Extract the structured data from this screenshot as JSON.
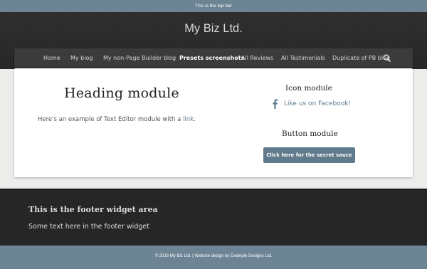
{
  "topbar": {
    "text": "This is the top bar"
  },
  "header": {
    "site_title": "My Biz Ltd."
  },
  "nav": {
    "items": [
      {
        "label": "Home"
      },
      {
        "label": "My blog"
      },
      {
        "label": "My non-Page Builder blog"
      },
      {
        "label": "Presets screenshots",
        "active": true
      },
      {
        "label": "All Reviews"
      },
      {
        "label": "All Testimonials"
      },
      {
        "label": "Duplicate of PB blog"
      }
    ],
    "search_icon": "search-icon"
  },
  "main": {
    "heading": "Heading module",
    "text_before_link": "Here's an example of Text Editor module with a ",
    "link_text": "link",
    "text_after_link": ".",
    "icon_module_title": "Icon module",
    "facebook_icon": "facebook-icon",
    "facebook_label": "Like us on Facebook!",
    "button_module_title": "Button module",
    "button_label": "Click here for the secret sauce",
    "colors": {
      "link": "#5b7c8f",
      "button": "#5f7a8b"
    }
  },
  "footer": {
    "title": "This is the footer widget area",
    "text": "Some text here in the footer widget"
  },
  "bottombar": {
    "text": "© 2016 My Biz Ltd. | Website design by Example Designs Ltd."
  },
  "colors": {
    "bars": "#6c8494",
    "header": "#2b2b2b",
    "footer": "#262626"
  }
}
